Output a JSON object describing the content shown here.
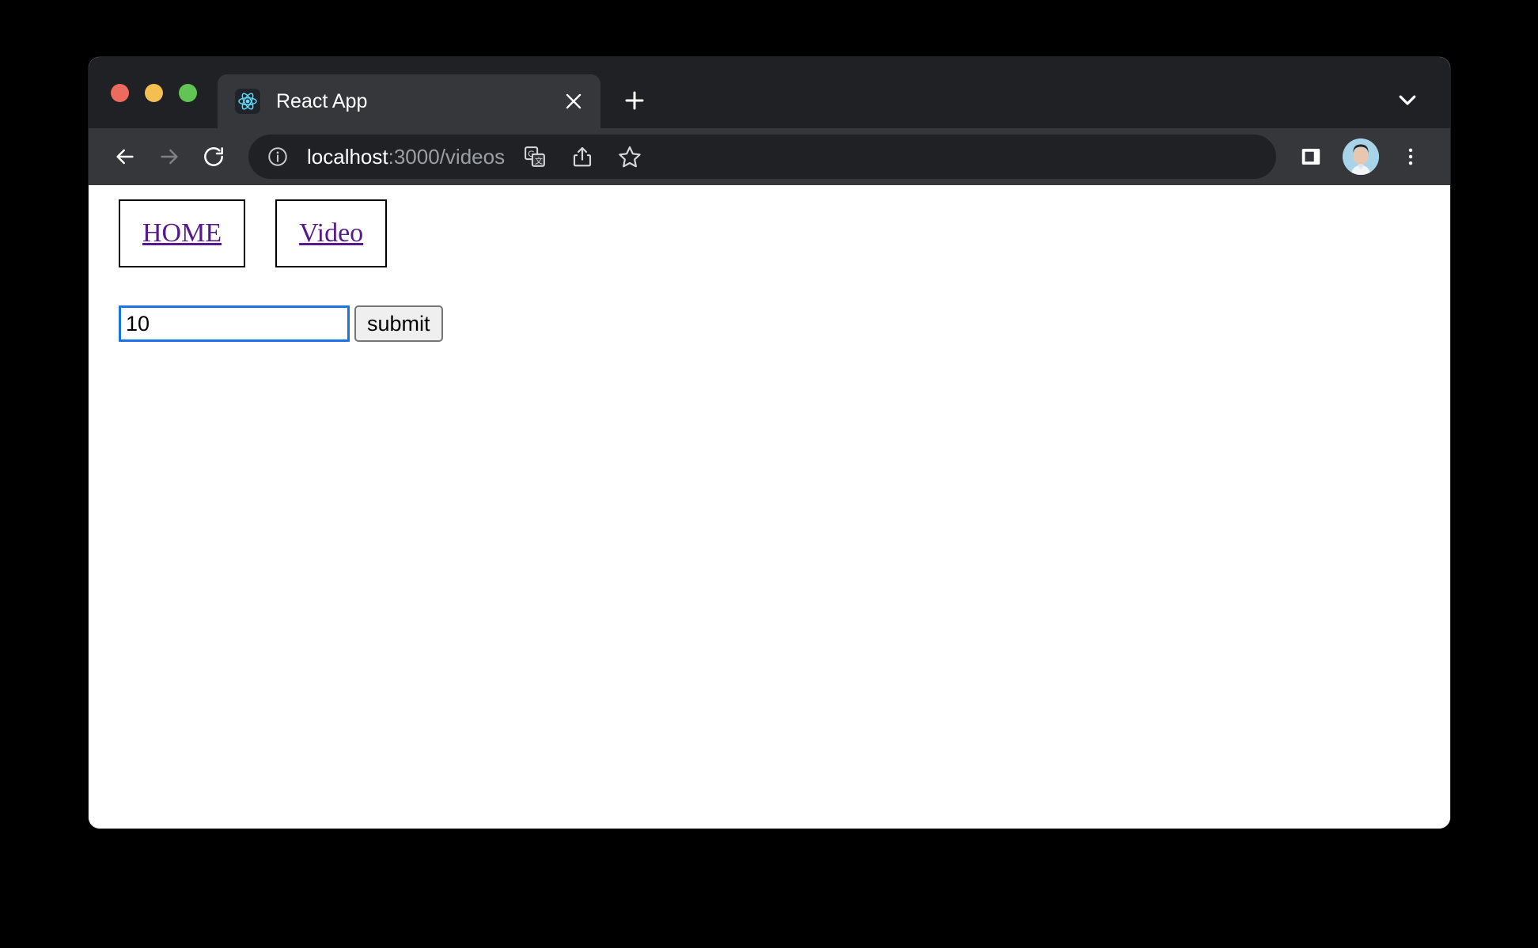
{
  "window": {
    "traffic_lights": [
      {
        "name": "close",
        "color": "#ed6a5f"
      },
      {
        "name": "minimize",
        "color": "#f4bf50"
      },
      {
        "name": "maximize",
        "color": "#61c455"
      }
    ]
  },
  "tabstrip": {
    "tabs": [
      {
        "title": "React App",
        "favicon": "react-logo-icon",
        "close_icon": "close-icon",
        "active": true
      }
    ],
    "new_tab_icon": "plus-icon",
    "tab_search_icon": "chevron-down-icon"
  },
  "toolbar": {
    "back_icon": "arrow-left-icon",
    "forward_icon": "arrow-right-icon",
    "reload_icon": "reload-icon",
    "site_info_icon": "info-circle-icon",
    "url": {
      "host": "localhost",
      "rest": ":3000/videos",
      "full": "localhost:3000/videos"
    },
    "translate_icon": "google-translate-icon",
    "share_icon": "share-icon",
    "bookmark_icon": "star-outline-icon",
    "side_panel_icon": "side-panel-icon",
    "avatar_icon": "profile-avatar",
    "menu_icon": "three-dot-menu-icon"
  },
  "page": {
    "nav_links": [
      {
        "label": "HOME"
      },
      {
        "label": "Video"
      }
    ],
    "form": {
      "input_value": "10",
      "input_placeholder": "",
      "submit_label": "submit"
    }
  },
  "colors": {
    "tabstrip_bg": "#202124",
    "toolbar_bg": "#35373b",
    "page_bg": "#ffffff",
    "link_purple": "#551a8b",
    "focus_blue": "#1a73e8",
    "react_cyan": "#61dafb"
  }
}
